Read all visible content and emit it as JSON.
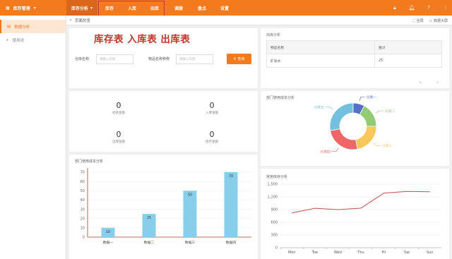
{
  "topbar": {
    "brand": "库存管理",
    "module": "库存分析",
    "nav": [
      "库存",
      "入库",
      "出库",
      "调拨",
      "盘点",
      "设置"
    ]
  },
  "sidebar": {
    "items": [
      {
        "label": "数据分析",
        "active": true
      },
      {
        "label": "使用说"
      }
    ]
  },
  "tabs": {
    "home": "页面总览",
    "fullscreen": "全屏",
    "data_screen": "数据大屏"
  },
  "annotation": "库存表 入库表 出库表",
  "query": {
    "warehouse_label": "仓库名称",
    "warehouse_placeholder": "请输入内容",
    "item_label": "物品名称称称",
    "item_placeholder": "请输入内容",
    "button": "查询"
  },
  "stats": [
    {
      "value": "0",
      "label": "初始金额"
    },
    {
      "value": "0",
      "label": "入库金额"
    },
    {
      "value": "0",
      "label": "出库金额"
    },
    {
      "value": "0",
      "label": "结存金额"
    }
  ],
  "outbound": {
    "title": "出库分析",
    "headers": [
      "物品名称",
      "数计"
    ],
    "rows": [
      [
        "矿泉水",
        "25"
      ]
    ]
  },
  "donut": {
    "title": "部门使用成本分析",
    "labels": [
      "分类一",
      "分类二",
      "分类三",
      "分类四",
      "分类五"
    ]
  },
  "colors": {
    "accent": "#f37b1d",
    "bar": "#87ceeb",
    "line": "#c0504d",
    "donut": [
      "#5470c6",
      "#91cc75",
      "#fac858",
      "#ee6666",
      "#73c0de"
    ]
  },
  "chart_data": [
    {
      "type": "bar",
      "title": "部门使用成本分析",
      "categories": [
        "数据一",
        "数据二",
        "数据三",
        "数据四"
      ],
      "values": [
        10,
        25,
        50,
        70
      ],
      "ylim": [
        0,
        70
      ],
      "yticks": [
        0,
        10,
        20,
        30,
        40,
        50,
        60,
        70
      ]
    },
    {
      "type": "pie",
      "title": "部门使用成本分析",
      "labels": [
        "分类一",
        "分类二",
        "分类三",
        "分类四",
        "分类五"
      ],
      "values": [
        8,
        17,
        22,
        25,
        28
      ]
    },
    {
      "type": "line",
      "title": "常用库存分析",
      "categories": [
        "Mon",
        "Tue",
        "Wed",
        "Thu",
        "Fri",
        "Sat",
        "Sun"
      ],
      "values": [
        820,
        932,
        901,
        934,
        1290,
        1330,
        1320
      ],
      "ylim": [
        0,
        1500
      ],
      "yticks": [
        0,
        300,
        600,
        900,
        1200,
        1500
      ]
    }
  ]
}
